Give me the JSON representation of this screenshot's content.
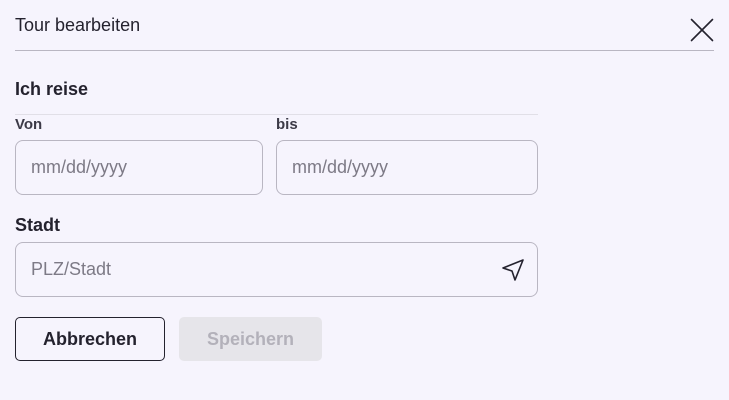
{
  "dialog": {
    "title": "Tour bearbeiten",
    "close_icon": "close-icon"
  },
  "travel": {
    "heading": "Ich reise",
    "from_label": "Von",
    "from_placeholder": "mm/dd/yyyy",
    "from_value": "",
    "to_label": "bis",
    "to_placeholder": "mm/dd/yyyy",
    "to_value": ""
  },
  "city": {
    "label": "Stadt",
    "placeholder": "PLZ/Stadt",
    "value": "",
    "locate_icon": "navigation-arrow-icon"
  },
  "actions": {
    "cancel_label": "Abbrechen",
    "save_label": "Speichern",
    "save_disabled": true
  },
  "colors": {
    "background": "#f6f4fd",
    "text": "#24222e",
    "border": "#b9b6c2",
    "placeholder": "#7d7a86",
    "disabled_bg": "#e6e5ea",
    "disabled_text": "#b3b1ba"
  }
}
